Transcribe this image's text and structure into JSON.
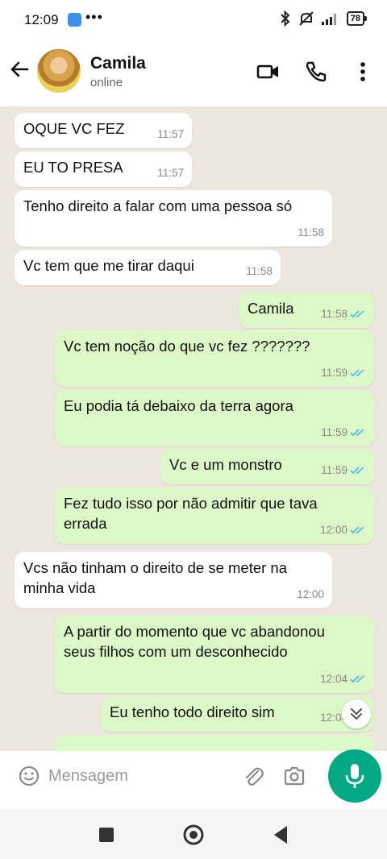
{
  "status_bar": {
    "time": "12:09",
    "dots": "•••",
    "battery": "78"
  },
  "header": {
    "contact_name": "Camila",
    "contact_status": "online"
  },
  "messages": [
    {
      "dir": "in",
      "text": "OQUE VC FEZ",
      "time": "11:57"
    },
    {
      "dir": "in",
      "text": "EU TO PRESA",
      "time": "11:57"
    },
    {
      "dir": "in",
      "text": "Tenho direito a falar com uma pessoa só",
      "time": "11:58"
    },
    {
      "dir": "in",
      "text": "Vc tem que me tirar daqui",
      "time": "11:58"
    },
    {
      "dir": "out",
      "text": "Camila",
      "time": "11:58",
      "read": true
    },
    {
      "dir": "out",
      "text": "Vc tem noção do que vc fez ???????",
      "time": "11:59",
      "read": true
    },
    {
      "dir": "out",
      "text": "Eu podia tá debaixo da terra agora",
      "time": "11:59",
      "read": true
    },
    {
      "dir": "out",
      "text": "Vc e um monstro",
      "time": "11:59",
      "read": true
    },
    {
      "dir": "out",
      "text": "Fez tudo isso por não admitir que tava errada",
      "time": "12:00",
      "read": true
    },
    {
      "dir": "in",
      "text": "Vcs não tinham o direito de se meter na minha vida",
      "time": "12:00"
    },
    {
      "dir": "out",
      "text": "A partir do momento que vc abandonou seus filhos com um desconhecido",
      "time": "12:04",
      "read": true
    },
    {
      "dir": "out",
      "text": "Eu tenho todo direito sim",
      "time": "12:04",
      "read": true
    }
  ],
  "input": {
    "placeholder": "Mensagem"
  },
  "colors": {
    "chat_background": "#ece6de",
    "incoming_bubble": "#ffffff",
    "outgoing_bubble": "#dcf8c6",
    "read_tick": "#53bdeb",
    "accent": "#00a884"
  },
  "icons": {
    "back": "arrow-left-icon",
    "video": "video-camera-icon",
    "call": "phone-icon",
    "menu": "more-vertical-icon",
    "emoji": "emoji-icon",
    "attach": "paperclip-icon",
    "camera": "camera-icon",
    "mic": "microphone-icon",
    "scroll_down": "double-chevron-down-icon"
  }
}
